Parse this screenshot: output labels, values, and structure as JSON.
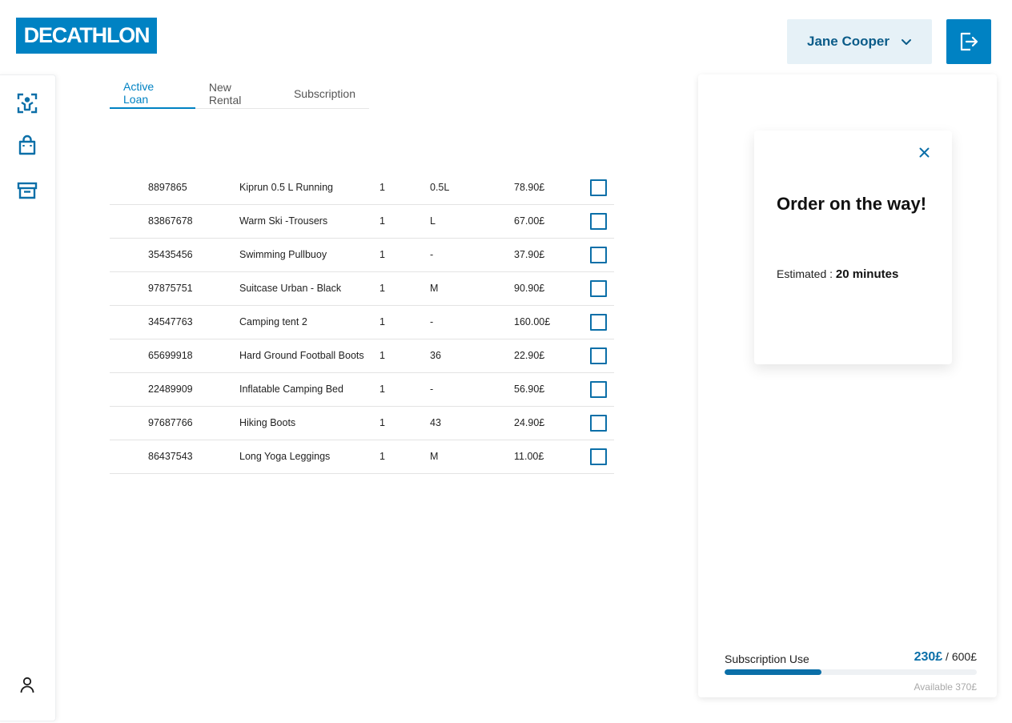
{
  "brand": {
    "logo_text": "DECATHLON",
    "color": "#0082c3"
  },
  "header": {
    "user_name": "Jane Cooper",
    "user_dropdown_icon": "chevron-down-icon",
    "logout_icon": "logout-icon"
  },
  "sidebar": {
    "items": [
      {
        "icon": "user-scan-icon"
      },
      {
        "icon": "shopping-bag-icon"
      },
      {
        "icon": "archive-box-icon"
      }
    ],
    "bottom_icon": "profile-icon"
  },
  "tabs": [
    {
      "label": "Active Loan",
      "active": true
    },
    {
      "label": "New Rental",
      "active": false
    },
    {
      "label": "Subscription",
      "active": false
    }
  ],
  "items": [
    {
      "id": "8897865",
      "name": "Kiprun 0.5 L Running",
      "qty": "1",
      "size": "0.5L",
      "price": "78.90£"
    },
    {
      "id": "83867678",
      "name": "Warm Ski -Trousers",
      "qty": "1",
      "size": "L",
      "price": "67.00£"
    },
    {
      "id": "35435456",
      "name": "Swimming Pullbuoy",
      "qty": "1",
      "size": "-",
      "price": "37.90£"
    },
    {
      "id": "97875751",
      "name": "Suitcase Urban - Black",
      "qty": "1",
      "size": "M",
      "price": "90.90£"
    },
    {
      "id": "34547763",
      "name": "Camping tent 2",
      "qty": "1",
      "size": " -",
      "price": "160.00£"
    },
    {
      "id": "65699918",
      "name": "Hard Ground Football Boots",
      "qty": "1",
      "size": "36",
      "price": "22.90£"
    },
    {
      "id": "22489909",
      "name": "Inflatable Camping Bed",
      "qty": "1",
      "size": "-",
      "price": "56.90£"
    },
    {
      "id": "97687766",
      "name": "Hiking Boots",
      "qty": "1",
      "size": "43",
      "price": "24.90£"
    },
    {
      "id": "86437543",
      "name": "Long Yoga Leggings",
      "qty": "1",
      "size": "M",
      "price": "11.00£"
    }
  ],
  "order_card": {
    "title": "Order on the way!",
    "estimate_label": "Estimated : ",
    "estimate_value": "20 minutes",
    "close_icon": "close-icon"
  },
  "subscription": {
    "label": "Subscription Use",
    "used": "230£",
    "total": " / 600£",
    "available": "Available 370£",
    "progress_fraction": 0.383,
    "accent": "#0b6fa8"
  }
}
